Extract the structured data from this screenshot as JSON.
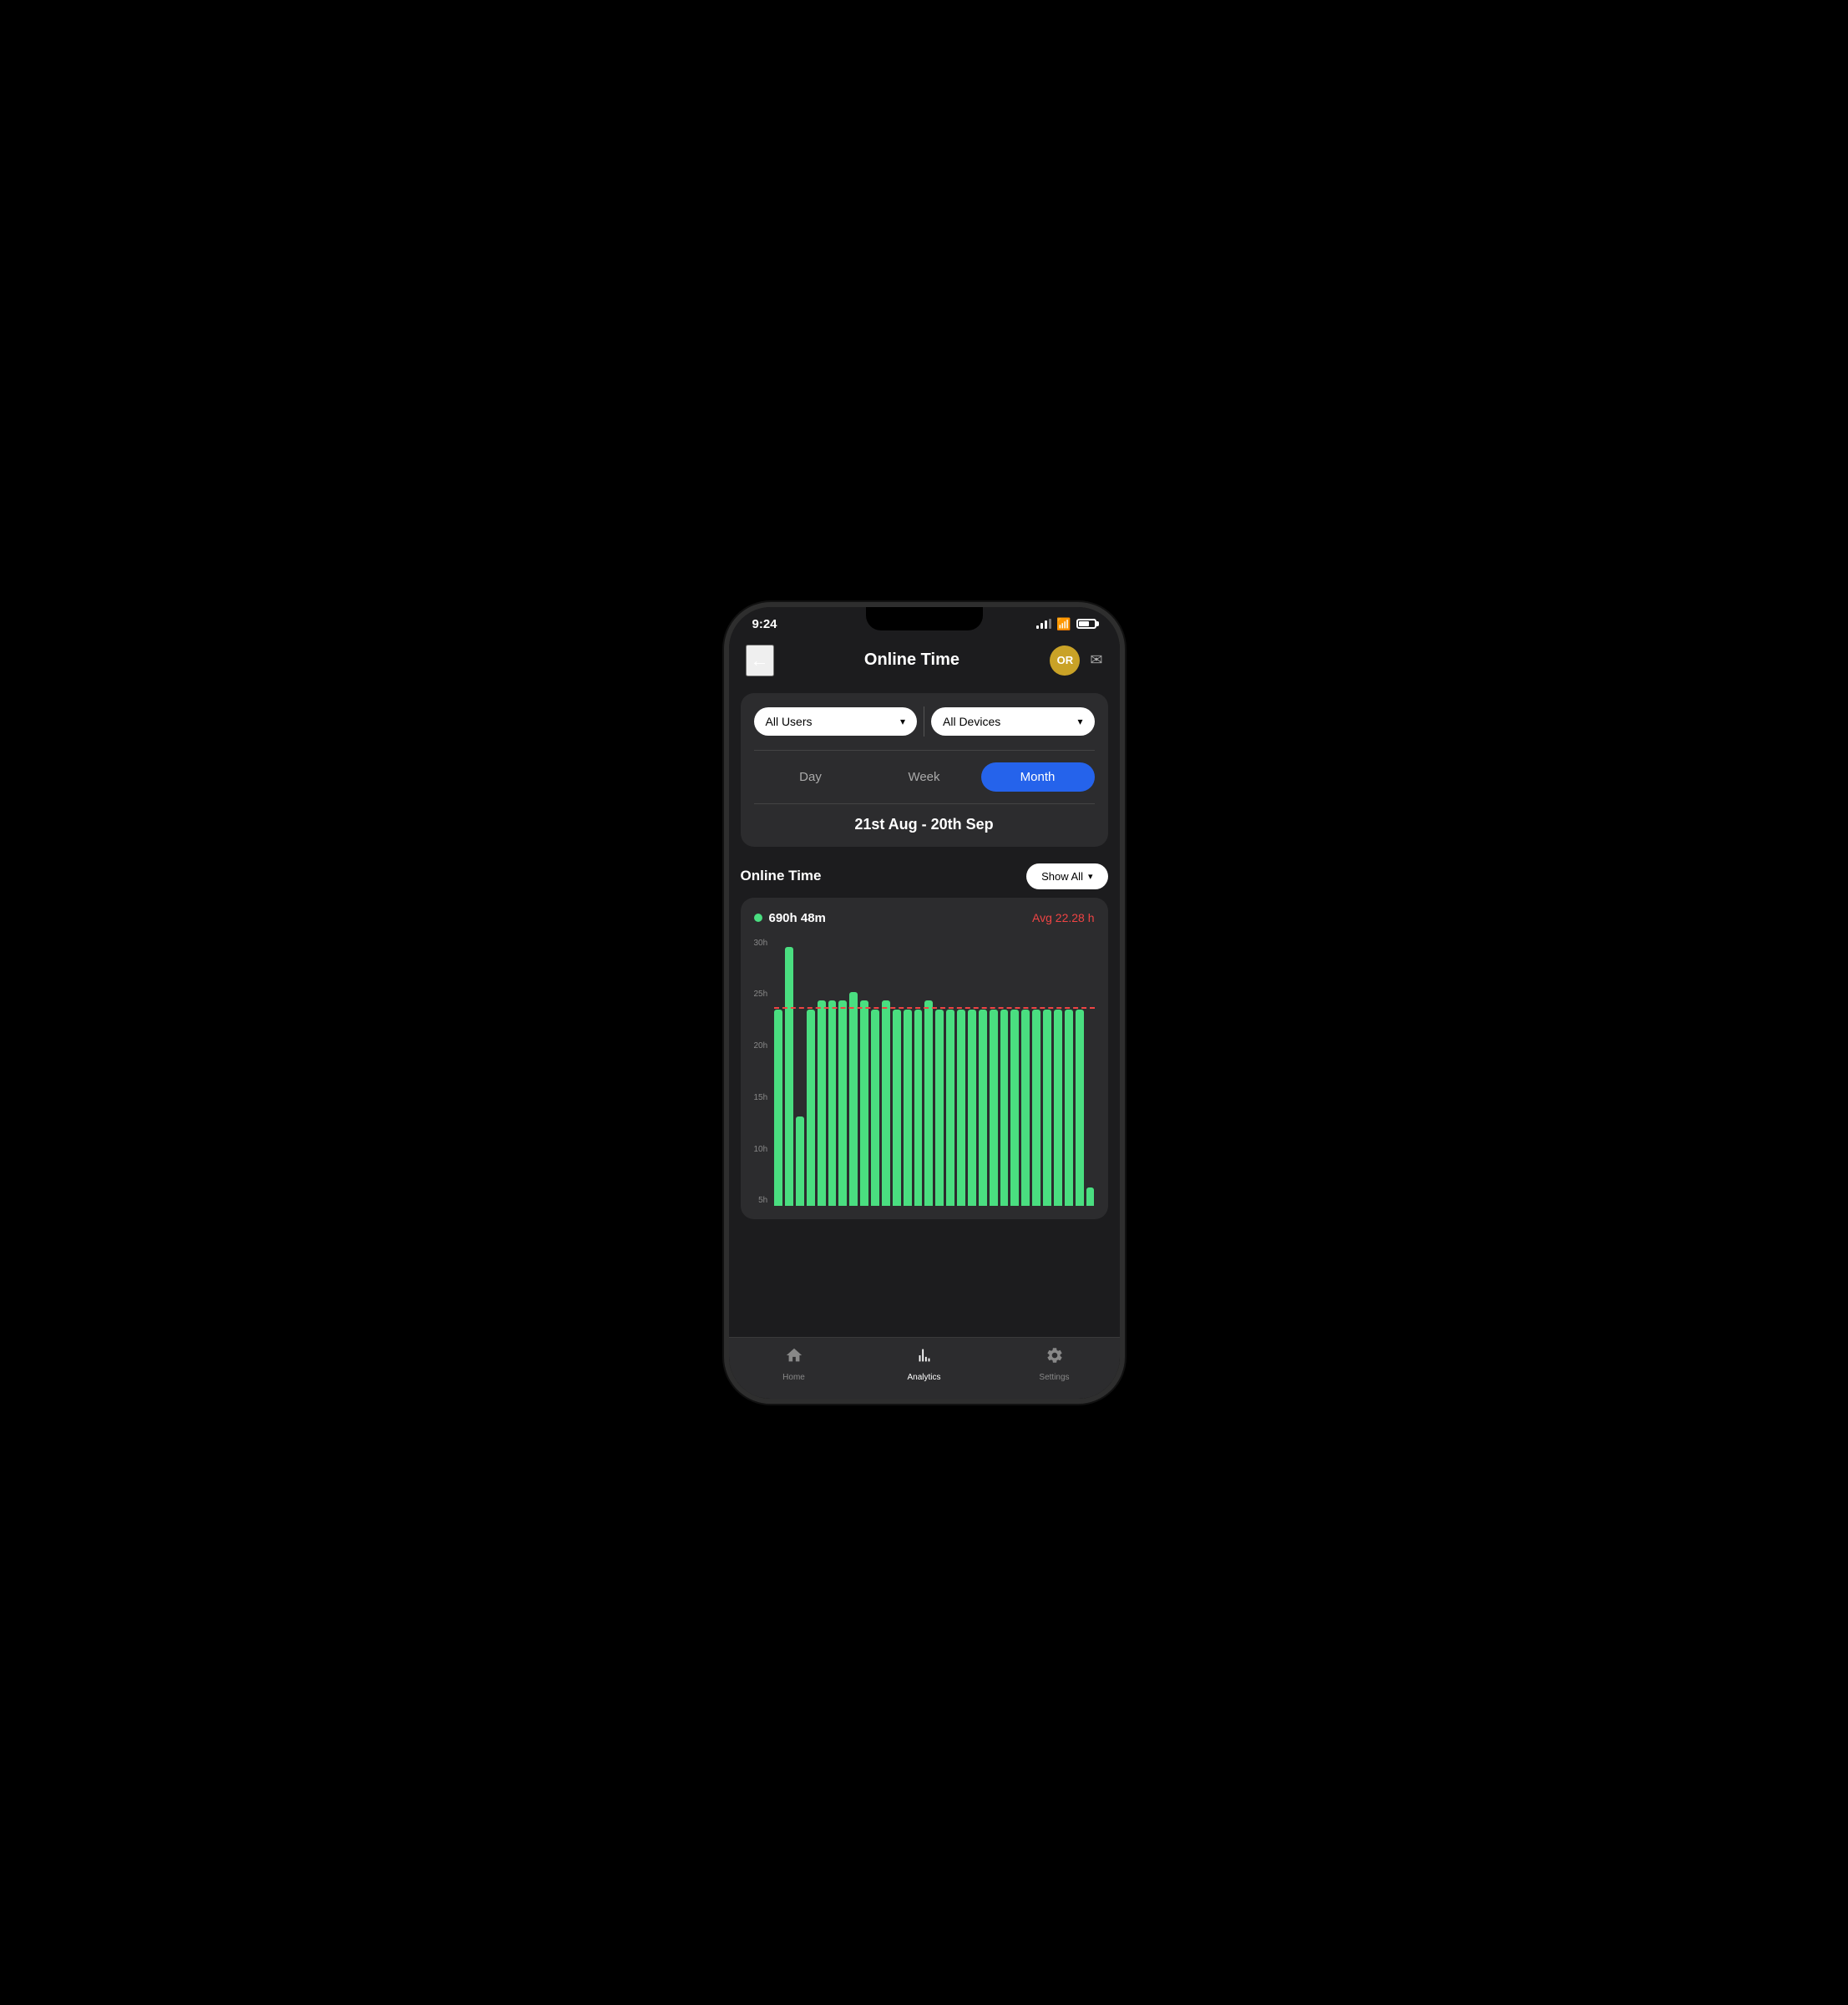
{
  "statusBar": {
    "time": "9:24",
    "battery": 70
  },
  "header": {
    "title": "Online Time",
    "avatarInitials": "OR",
    "backLabel": "←"
  },
  "filters": {
    "usersDropdown": "All Users",
    "devicesDropdown": "All Devices",
    "periods": [
      "Day",
      "Week",
      "Month"
    ],
    "activePeriod": "Month",
    "dateRange": "21st Aug - 20th Sep"
  },
  "section": {
    "title": "Online Time",
    "showAllLabel": "Show All"
  },
  "chart": {
    "legendValue": "690h 48m",
    "avgLabel": "Avg 22.28 h",
    "yAxisLabels": [
      "30h",
      "25h",
      "20h",
      "15h",
      "10h",
      "5h"
    ],
    "maxValue": 30,
    "avgValue": 22.28,
    "bars": [
      22,
      29,
      10,
      22,
      23,
      23,
      23,
      24,
      23,
      22,
      23,
      22,
      22,
      22,
      23,
      22,
      22,
      22,
      22,
      22,
      22,
      22,
      22,
      22,
      22,
      22,
      22,
      22,
      22,
      2
    ]
  },
  "bottomNav": {
    "items": [
      {
        "id": "home",
        "label": "Home",
        "icon": "🏠",
        "active": false
      },
      {
        "id": "analytics",
        "label": "Analytics",
        "icon": "📊",
        "active": true
      },
      {
        "id": "settings",
        "label": "Settings",
        "icon": "⚙️",
        "active": false
      }
    ]
  }
}
